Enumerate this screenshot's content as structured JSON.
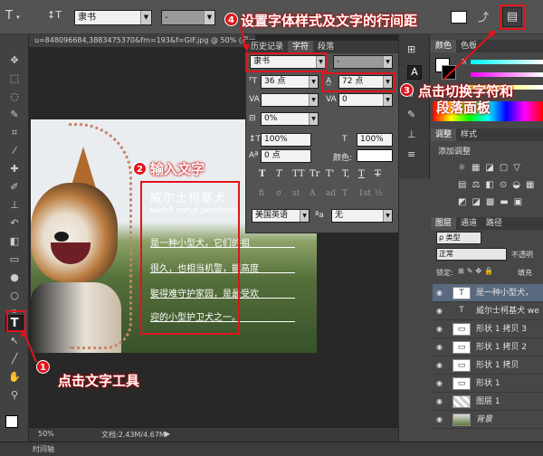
{
  "options_bar": {
    "tool_glyph": "T",
    "orient_glyph": "↕T",
    "font_family": "隶书",
    "font_style": "-",
    "warp_glyph": "⤴",
    "panel_toggle_glyph": "▤"
  },
  "document": {
    "tab_title": "u=848096684,3883475370&fm=193&f=GIF.jpg @ 50% (是一种",
    "zoom": "50%",
    "doc_info": "文档:2.43M/4.67M"
  },
  "image_text": {
    "title": "威尔士柯基犬",
    "subtitle": "welsh corgi pembrok",
    "lines": [
      "是一种小型犬，它们的祖",
      "很久，也相当机警，能高度",
      "娶得难守护家园，是最受欢",
      "迎的小型护卫犬之一。"
    ]
  },
  "character_panel": {
    "tabs": [
      "历史记录",
      "字符",
      "段落"
    ],
    "font_family": "隶书",
    "font_style": "-",
    "font_size": "36 点",
    "leading": "72 点",
    "kerning": "",
    "tracking": "0",
    "tsume": "0%",
    "vscale": "100%",
    "hscale": "100%",
    "baseline": "0 点",
    "color_label": "颜色:",
    "style_buttons": [
      "T",
      "T",
      "TT",
      "Tr",
      "T'",
      "T,",
      "T",
      "T"
    ],
    "opentype_buttons": [
      "fi",
      "σ",
      "st",
      "A",
      "ad",
      "T",
      "1st",
      "½"
    ],
    "language": "美国英语",
    "aa_label": "ªa",
    "antialias": "无"
  },
  "right_panels": {
    "color_tabs": [
      "颜色",
      "色板"
    ],
    "color_channel_r": "R",
    "adjust_tabs": [
      "调整",
      "样式"
    ],
    "adjust_title": "添加调整",
    "layers_tabs": [
      "图层",
      "通道",
      "路径"
    ],
    "kind_filter": "ρ 类型",
    "blend_mode": "正常",
    "opacity_label": "不透明",
    "lock_label": "锁定:",
    "fill_label": "填充",
    "layers": [
      {
        "name": "是一种小型犬，",
        "type": "text",
        "selected": true
      },
      {
        "name": "威尔士柯基犬 we",
        "type": "text",
        "selected": false
      },
      {
        "name": "形状 1 拷贝 3",
        "type": "shape",
        "selected": false
      },
      {
        "name": "形状 1 拷贝 2",
        "type": "shape",
        "selected": false
      },
      {
        "name": "形状 1 拷贝",
        "type": "shape",
        "selected": false
      },
      {
        "name": "形状 1",
        "type": "shape",
        "selected": false
      },
      {
        "name": "图层 1",
        "type": "pixel",
        "selected": false
      },
      {
        "name": "背景",
        "type": "background",
        "selected": false
      }
    ]
  },
  "timeline_label": "时间轴",
  "annotations": {
    "a1": {
      "num": "1",
      "text": "点击文字工具"
    },
    "a2": {
      "num": "2",
      "text": "输入文字"
    },
    "a3": {
      "num": "3",
      "text": "点击切换字符和",
      "text2": "段落面板"
    },
    "a4": {
      "num": "4",
      "text": "设置字体样式及文字的行间距"
    }
  },
  "colors": {
    "annotation_red": "#e0141c",
    "layer_selected": "#596a80"
  }
}
